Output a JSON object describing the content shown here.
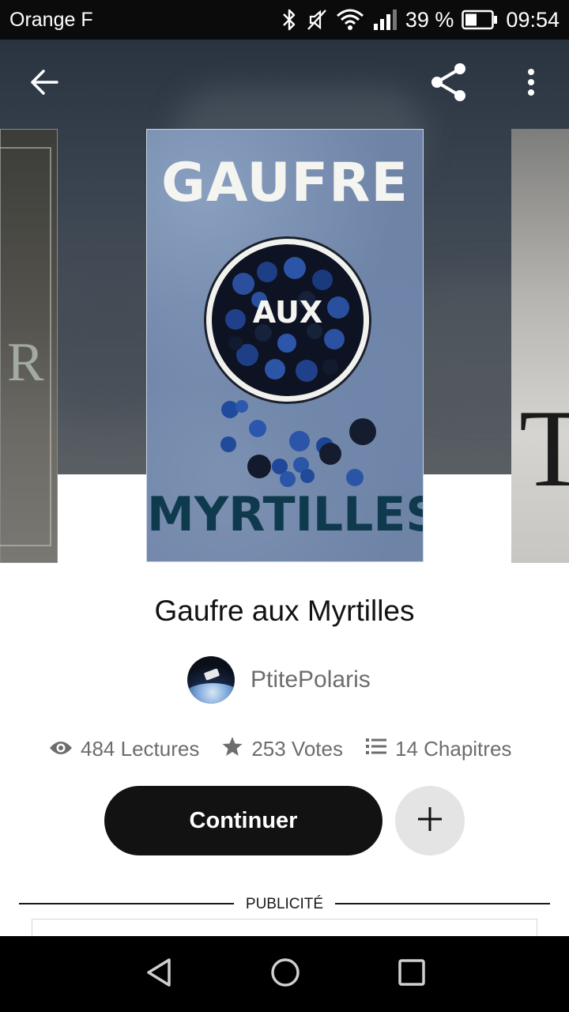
{
  "status_bar": {
    "carrier": "Orange F",
    "battery_percent": "39 %",
    "time": "09:54",
    "icons": [
      "bluetooth-icon",
      "mute-icon",
      "wifi-icon",
      "signal-icon",
      "battery-icon"
    ]
  },
  "toolbar": {
    "icons": [
      "back-arrow-icon",
      "share-icon",
      "more-vert-icon"
    ]
  },
  "cover": {
    "title_top": "GAUFRE",
    "title_middle": "AUX",
    "title_bottom": "MYRTILLES"
  },
  "book": {
    "title": "Gaufre aux Myrtilles",
    "author": "PtitePolaris",
    "stats": {
      "reads": "484 Lectures",
      "votes": "253 Votes",
      "chapters": "14 Chapitres"
    },
    "continue_label": "Continuer"
  },
  "ad": {
    "label": "PUBLICITÉ"
  },
  "nav_bar": {
    "icons": [
      "nav-back-icon",
      "nav-home-icon",
      "nav-recent-icon"
    ]
  },
  "colors": {
    "primary_button": "#121212",
    "secondary_button": "#e4e4e4",
    "text_muted": "#6d6d6d"
  }
}
